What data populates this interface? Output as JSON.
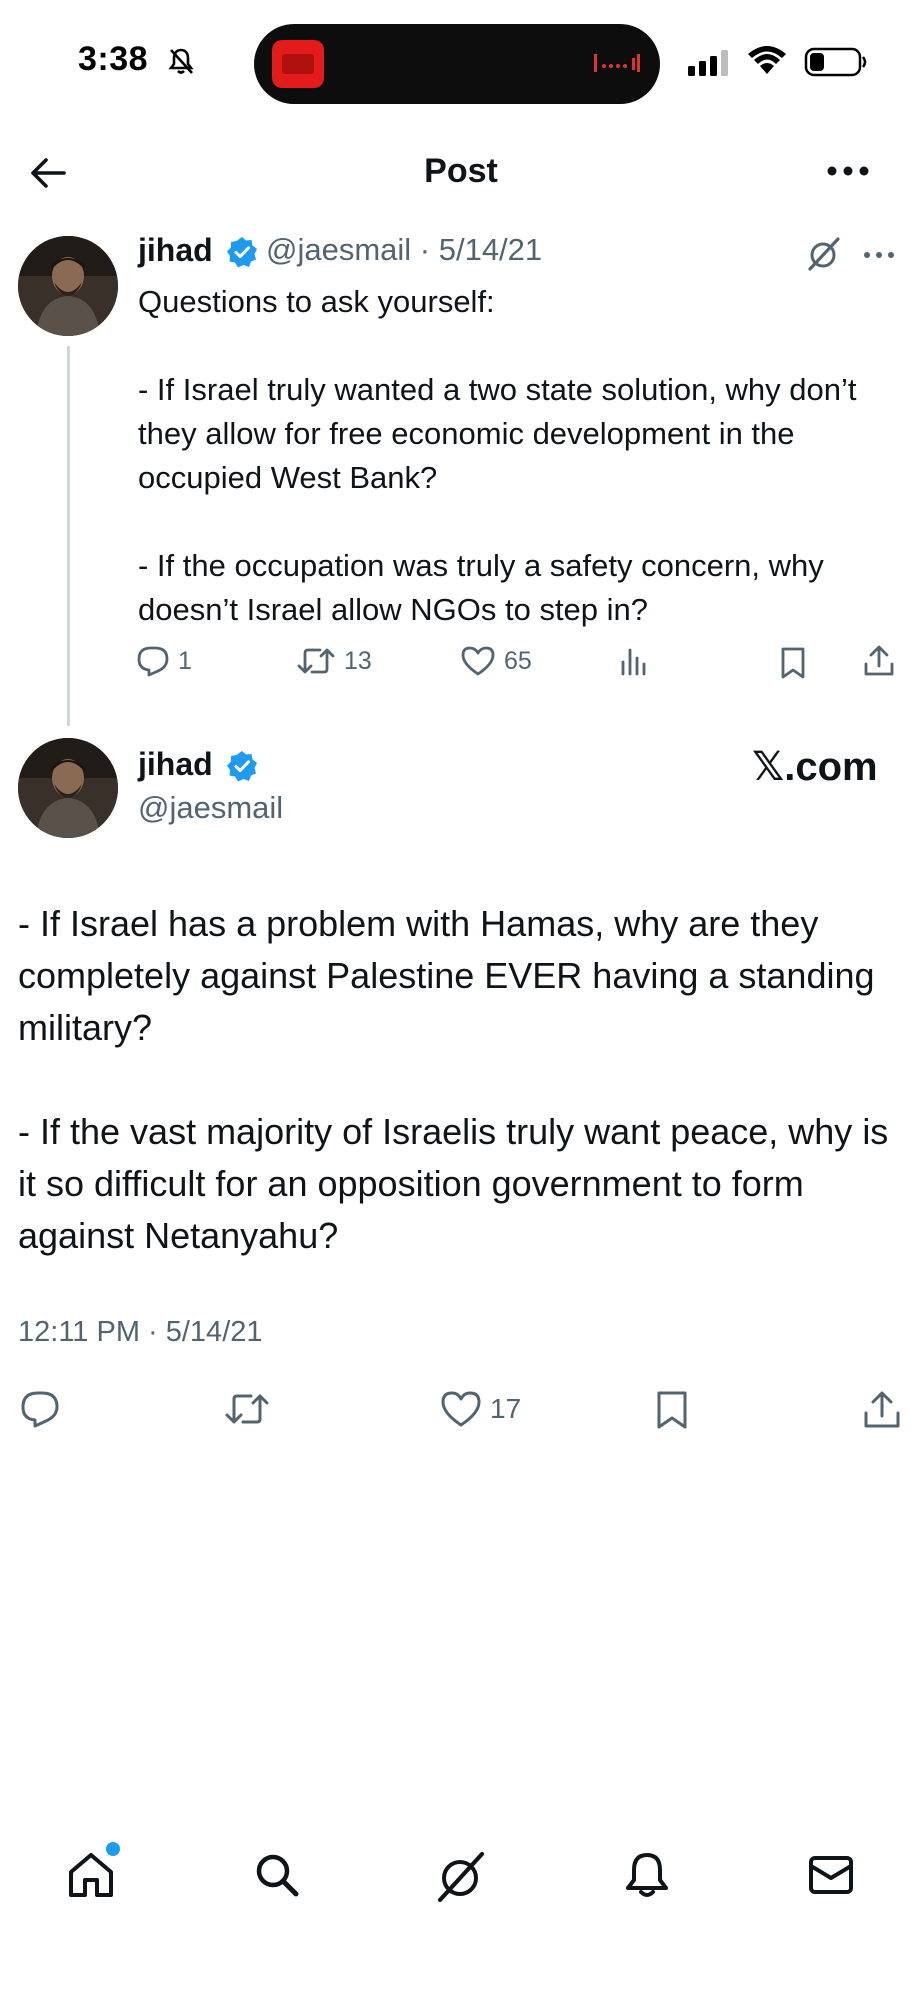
{
  "status_bar": {
    "time": "3:38",
    "icons": [
      "bell-muted-icon",
      "recording-icon",
      "cellular-signal-icon",
      "wifi-icon",
      "battery-icon"
    ]
  },
  "header": {
    "title": "Post",
    "back_icon": "arrow-left-icon",
    "more_icon": "more-horizontal-icon"
  },
  "quoted_tweet": {
    "name": "jihad",
    "handle_date": "@jaesmail · 5/14/21",
    "text": "Questions to ask yourself:\n\n- If Israel truly wanted a two state solution, why don’t they allow for free economic development in the occupied West Bank?\n\n- If the occupation was truly a safety concern, why doesn’t Israel allow NGOs to step in?",
    "actions": {
      "replies": "1",
      "reposts": "13",
      "likes": "65"
    }
  },
  "main_tweet": {
    "name": "jihad",
    "handle": "@jaesmail",
    "brand": "𝕏.com",
    "text": "- If Israel has a problem with Hamas, why are they completely against Palestine EVER having a standing military?\n\n- If the vast majority of Israelis truly want peace, why is it so difficult for an opposition government to form against Netanyahu?",
    "timestamp": "12:11 PM · 5/14/21",
    "actions": {
      "likes": "17"
    }
  },
  "colors": {
    "accent": "#1d9bf0",
    "text": "#0f1419",
    "muted": "#536471",
    "divider": "#cfd9de"
  },
  "bottom_nav": [
    "home-icon",
    "search-icon",
    "grok-icon",
    "notifications-icon",
    "messages-icon"
  ]
}
